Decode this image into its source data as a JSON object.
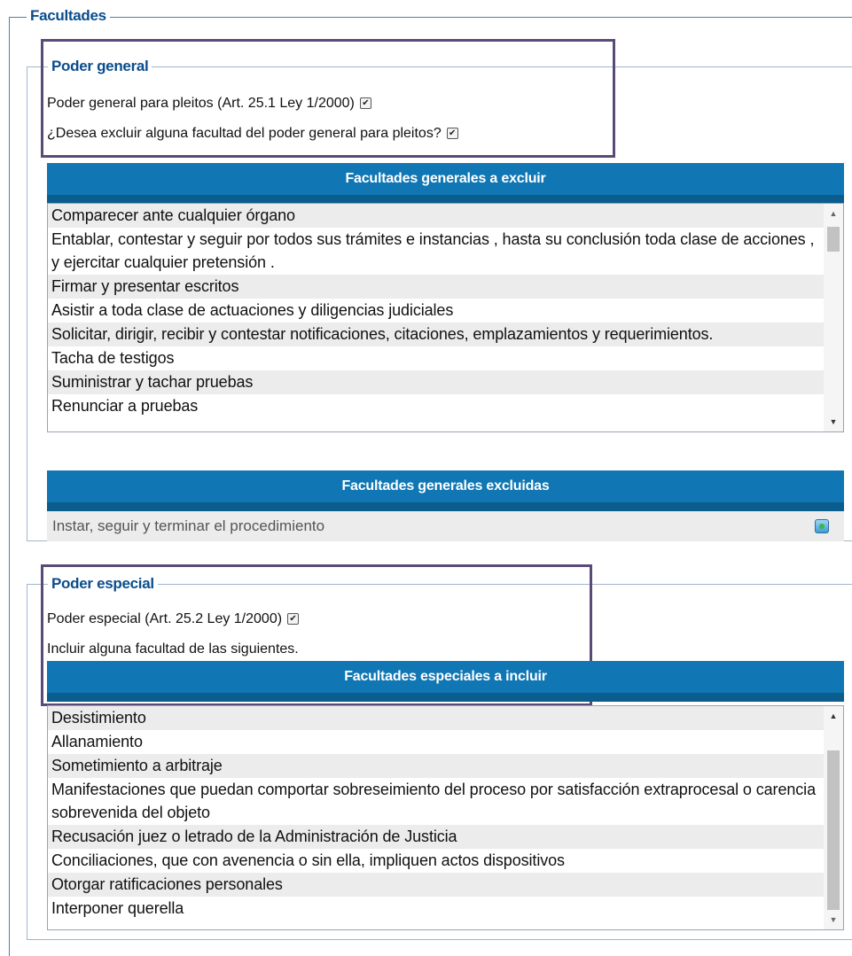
{
  "facultades": {
    "legend": "Facultades"
  },
  "poder_general": {
    "legend": "Poder general",
    "pleitos_label": "Poder general para pleitos (Art. 25.1 Ley 1/2000)",
    "pleitos_checked": true,
    "excluir_label": "¿Desea excluir alguna facultad del poder general para pleitos?",
    "excluir_checked": true,
    "excluir_header": "Facultades generales a excluir",
    "excluir_items": [
      "Comparecer ante cualquier órgano",
      "Entablar, contestar y seguir por todos sus trámites e instancias , hasta su conclusión toda clase de acciones , y ejercitar cualquier pretensión .",
      "Firmar y presentar escritos",
      "Asistir a toda clase de actuaciones y diligencias judiciales",
      "Solicitar, dirigir, recibir y contestar notificaciones, citaciones, emplazamientos y requerimientos.",
      "Tacha de testigos",
      "Suministrar y tachar pruebas",
      "Renunciar a pruebas"
    ],
    "excluidas_header": "Facultades generales excluidas",
    "excluidas_items": [
      "Instar, seguir y terminar el procedimiento"
    ]
  },
  "poder_especial": {
    "legend": "Poder especial",
    "especial_label": "Poder especial (Art. 25.2 Ley 1/2000)",
    "especial_checked": true,
    "incluir_text": "Incluir alguna facultad de las siguientes.",
    "incluir_header": "Facultades especiales a incluir",
    "incluir_items": [
      "Desistimiento",
      "Allanamiento",
      "Sometimiento a arbitraje",
      "Manifestaciones que puedan comportar sobreseimiento del proceso por satisfacción extraprocesal o carencia sobrevenida del objeto",
      "Recusación juez o letrado de la Administración de Justicia",
      "Conciliaciones, que con avenencia o sin ella, impliquen actos dispositivos",
      "Otorgar ratificaciones personales",
      "Interponer querella"
    ]
  },
  "icons": {
    "checkbox": "checkmark-icon",
    "delete": "trash-icon"
  }
}
